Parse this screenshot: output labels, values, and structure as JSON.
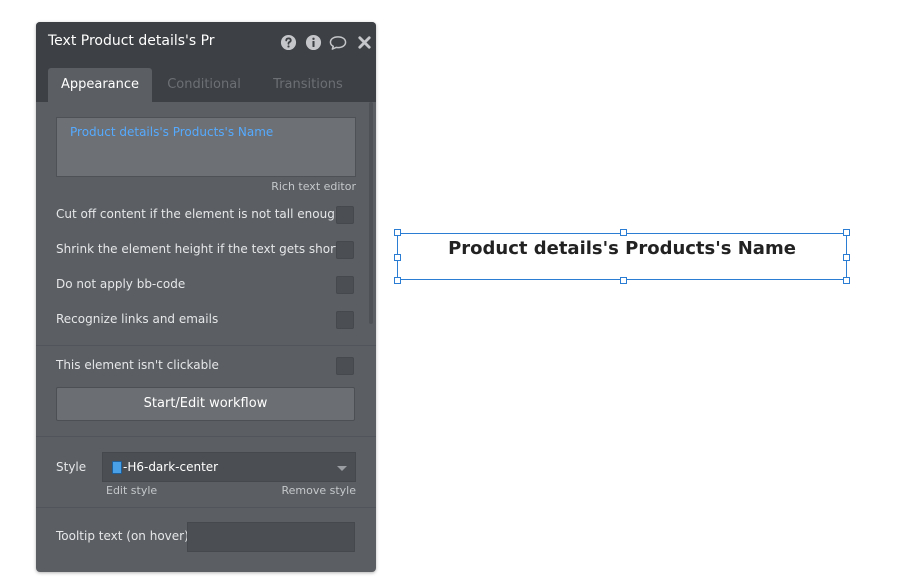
{
  "panel": {
    "title": "Text Product details's Pr",
    "header_icons": [
      "help-icon",
      "info-icon",
      "comment-icon",
      "close-icon"
    ],
    "tabs": [
      {
        "label": "Appearance",
        "active": true
      },
      {
        "label": "Conditional",
        "active": false
      },
      {
        "label": "Transitions",
        "active": false
      }
    ],
    "editor": {
      "content": "Product details's Products's Name",
      "rich_text_link": "Rich text editor"
    },
    "options": [
      {
        "label": "Cut off content if the element is not tall enough",
        "checked": false
      },
      {
        "label": "Shrink the element height if the text gets shorter",
        "checked": false
      },
      {
        "label": "Do not apply bb-code",
        "checked": false
      },
      {
        "label": "Recognize links and emails",
        "checked": false
      }
    ],
    "clickable": {
      "label": "This element isn't clickable",
      "checked": false
    },
    "workflow_button": "Start/Edit workflow",
    "style": {
      "label": "Style",
      "value": "-H6-dark-center",
      "edit_link": "Edit style",
      "remove_link": "Remove style"
    },
    "tooltip": {
      "label": "Tooltip text (on hover)",
      "value": ""
    }
  },
  "canvas": {
    "element_text": "Product details's Products's Name"
  },
  "colors": {
    "panel_bg": "#5b5e62",
    "header_bg": "#3d4044",
    "link_blue": "#55aaff",
    "selection_blue": "#2b7cd3"
  }
}
